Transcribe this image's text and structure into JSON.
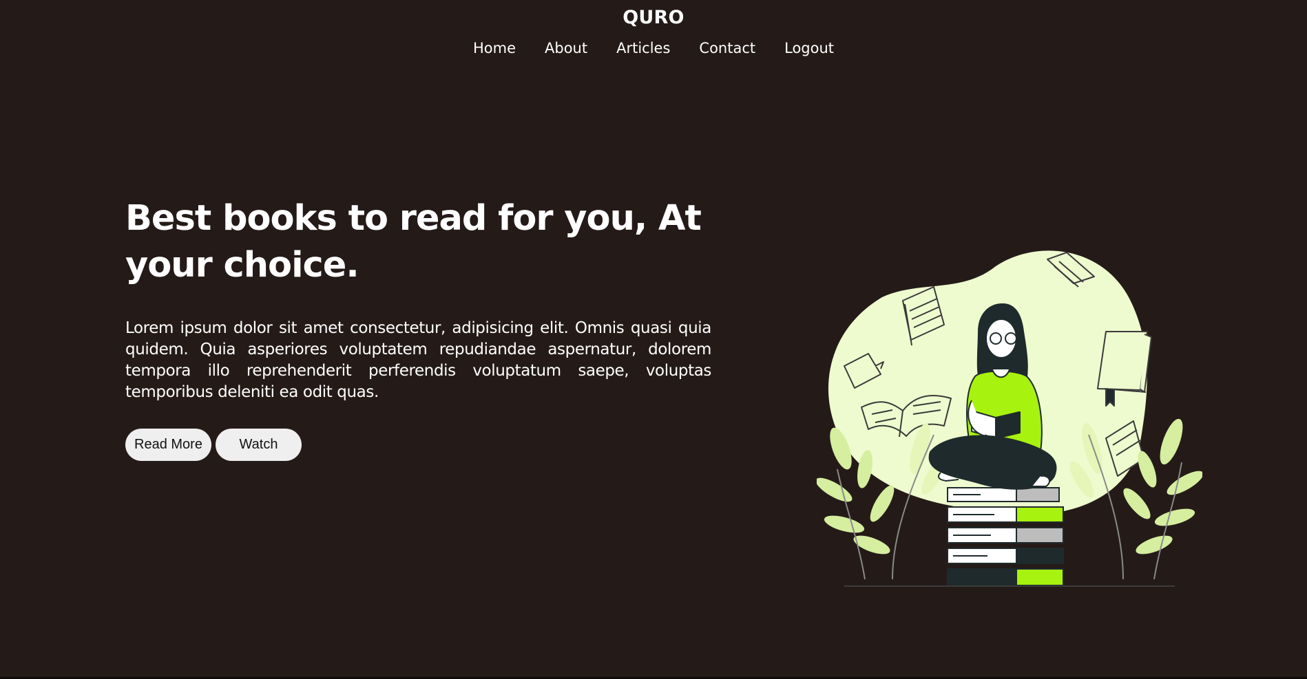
{
  "brand": "QURO",
  "nav": {
    "items": [
      {
        "label": "Home"
      },
      {
        "label": "About"
      },
      {
        "label": "Articles"
      },
      {
        "label": "Contact"
      },
      {
        "label": "Logout"
      }
    ]
  },
  "hero": {
    "title": "Best books to read for you, At your choice.",
    "description": "Lorem ipsum dolor sit amet consectetur, adipisicing elit. Omnis quasi quia quidem. Quia asperiores voluptatem repudiandae aspernatur, dolorem tempora illo reprehenderit perferendis voluptatum saepe, voluptas temporibus deleniti ea odit quas.",
    "read_more_label": "Read More",
    "watch_label": "Watch"
  },
  "illustration": {
    "icon": "reading-woman-illustration"
  },
  "colors": {
    "background": "#241b18",
    "accent": "#a8f20f",
    "blob": "#eefbcf",
    "leaf": "#d5ee9f",
    "ink": "#1f2a2c",
    "button": "#f0efef"
  }
}
